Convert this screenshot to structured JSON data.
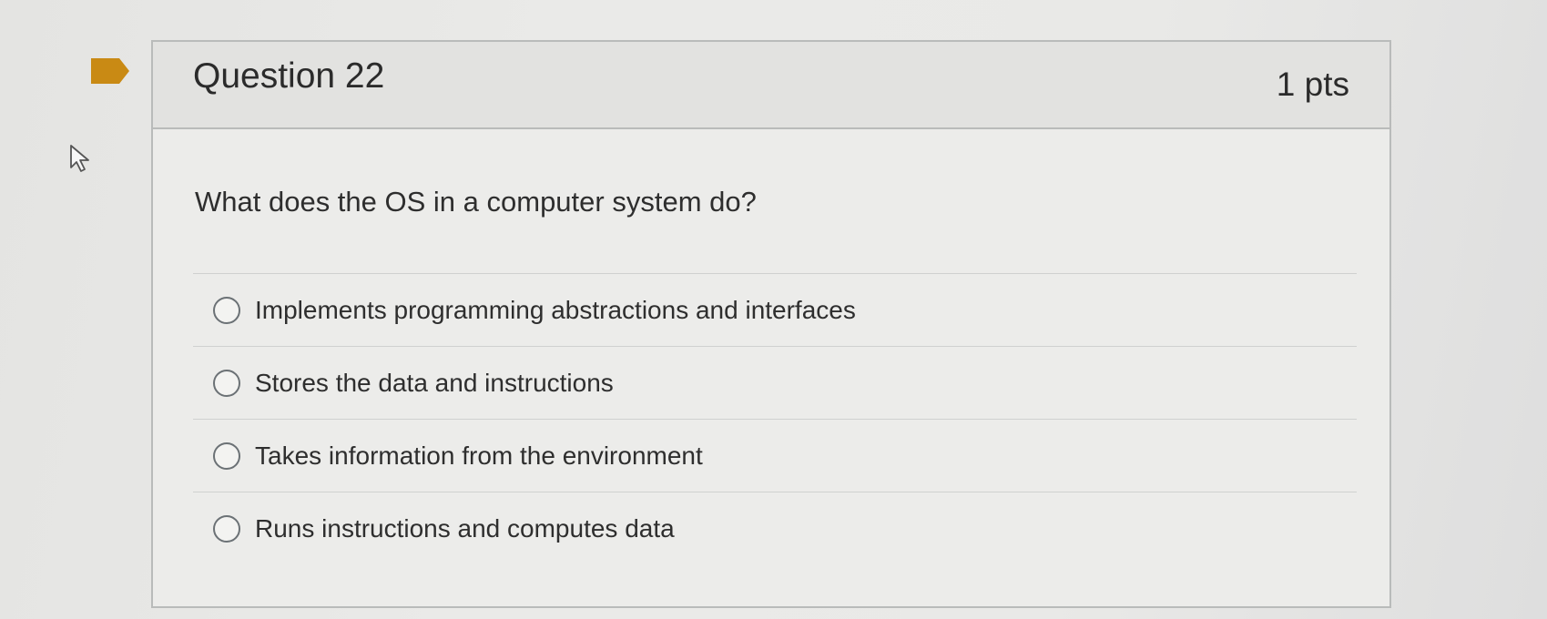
{
  "question": {
    "title": "Question 22",
    "points": "1 pts",
    "prompt": "What does the OS in a computer system do?",
    "answers": [
      {
        "label": "Implements programming abstractions and interfaces",
        "selected": false
      },
      {
        "label": "Stores the data and instructions",
        "selected": false
      },
      {
        "label": "Takes information from the environment",
        "selected": false
      },
      {
        "label": "Runs instructions and computes data",
        "selected": false
      }
    ]
  },
  "colors": {
    "flag": "#c98a14",
    "border": "#b9bbba",
    "header_bg": "#e2e2e0"
  },
  "icons": {
    "flag": "bookmark-flag-icon",
    "cursor": "mouse-pointer-icon"
  }
}
